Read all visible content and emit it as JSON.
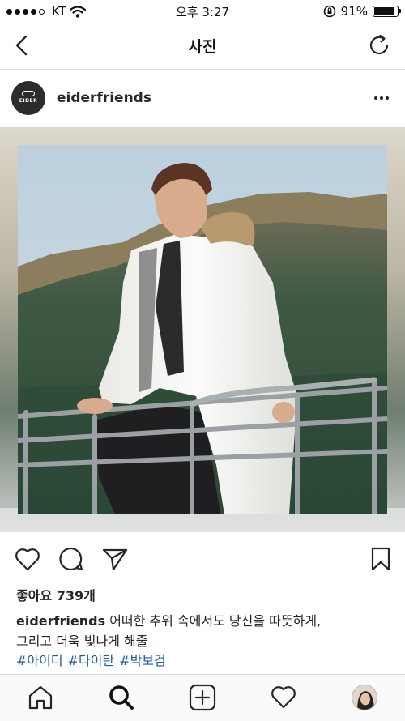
{
  "status_bar": {
    "carrier": "KT",
    "time": "오후 3:27",
    "battery": "91%",
    "battery_level": 0.91
  },
  "nav": {
    "title": "사진"
  },
  "post": {
    "username": "eiderfriends",
    "avatar_logo": "EIDER",
    "likes": "좋아요 739개",
    "caption_user": "eiderfriends",
    "caption_line1": "어떠한 추위 속에서도 당신을 따뜻하게,",
    "caption_line2": "그리고 더욱 빛나게 해줄",
    "hashtags": [
      "#아이더",
      "#타이탄",
      "#박보검"
    ]
  },
  "icons": {
    "back": "chevron-left-icon",
    "refresh": "refresh-icon",
    "more": "more-icon",
    "like": "heart-icon",
    "comment": "comment-icon",
    "share": "send-icon",
    "save": "bookmark-icon",
    "home": "home-icon",
    "search": "search-icon",
    "add": "add-post-icon",
    "activity": "heart-icon",
    "profile": "profile-avatar"
  },
  "colors": {
    "hashtag": "#1e5aa8",
    "text": "#262626",
    "divider": "#dbdbdb"
  }
}
